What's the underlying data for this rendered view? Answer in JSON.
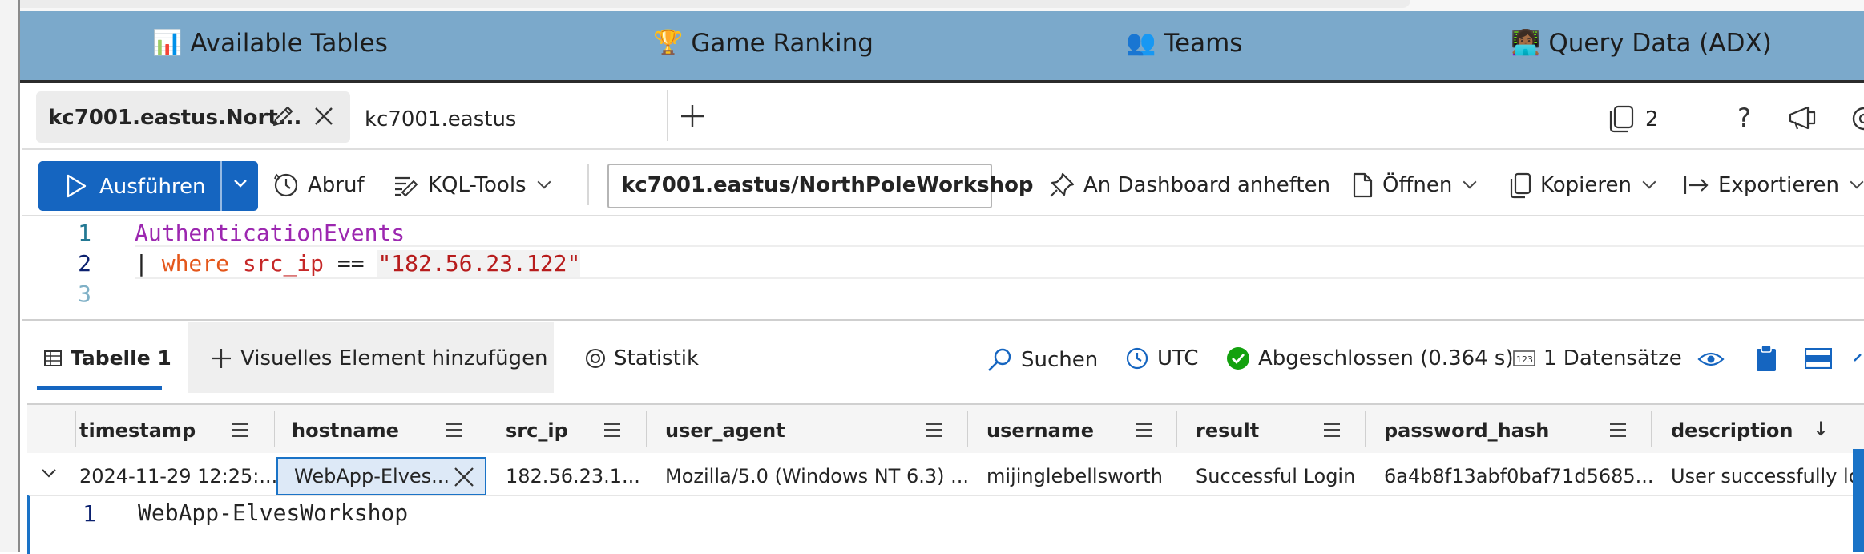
{
  "nav": {
    "items": [
      {
        "emoji": "📊",
        "label": "Available Tables"
      },
      {
        "emoji": "🏆",
        "label": "Game Ranking"
      },
      {
        "emoji": "👥",
        "label": "Teams"
      },
      {
        "emoji": "👩🏾‍💻",
        "label": "Query Data (ADX)"
      }
    ]
  },
  "tabs": {
    "active": "kc7001.eastus.Nort...",
    "second": "kc7001.eastus",
    "count": "2"
  },
  "toolbar": {
    "run": "Ausführen",
    "recall": "Abruf",
    "kql_tools": "KQL-Tools",
    "database": "kc7001.eastus/NorthPoleWorkshop",
    "pin": "An Dashboard anheften",
    "open": "Öffnen",
    "copy": "Kopieren",
    "export": "Exportieren"
  },
  "editor": {
    "line_numbers": [
      "1",
      "2",
      "3"
    ],
    "line1": "AuthenticationEvents",
    "pipe": "| ",
    "kw_where": "where",
    "field": " src_ip ",
    "op": "==",
    "space": " ",
    "string": "\"182.56.23.122\""
  },
  "results": {
    "table_tab": "Tabelle 1",
    "add_visual": "Visuelles Element hinzufügen",
    "stats": "Statistik",
    "search": "Suchen",
    "timezone": "UTC",
    "status": "Abgeschlossen (0.364 s)",
    "records": "1 Datensätze"
  },
  "grid": {
    "columns": [
      "timestamp",
      "hostname",
      "src_ip",
      "user_agent",
      "username",
      "result",
      "password_hash",
      "description"
    ],
    "row": {
      "timestamp": "2024-11-29 12:25:...",
      "hostname": "WebApp-Elves...",
      "src_ip": "182.56.23.1...",
      "user_agent": "Mozilla/5.0 (Windows NT 6.3) ...",
      "username": "mijinglebellsworth",
      "result": "Successful Login",
      "password_hash": "6a4b8f13abf0baf71d5685...",
      "description": "User successfully logg"
    }
  },
  "detail": {
    "line_number": "1",
    "value": "WebApp-ElvesWorkshop"
  },
  "colors": {
    "nav_bg": "#7ba9cb",
    "accent": "#1565c0",
    "keyword_purple": "#9c27b0",
    "keyword_orange": "#e4571b",
    "string_red": "#c62828",
    "success_green": "#13a10e"
  }
}
